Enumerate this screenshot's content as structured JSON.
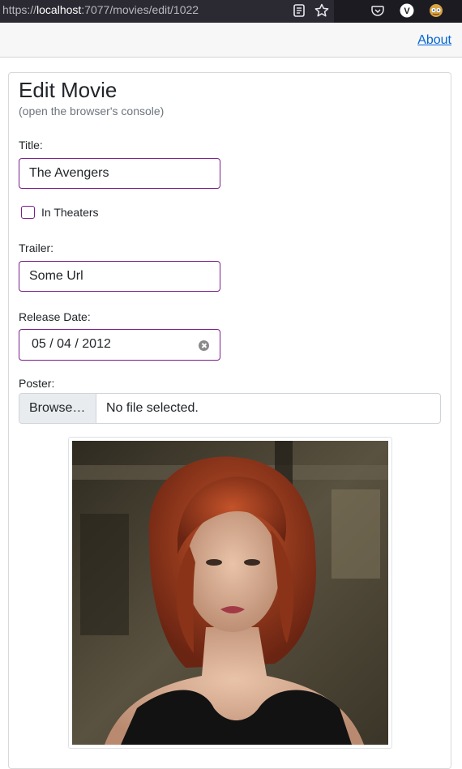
{
  "browser": {
    "url_scheme": "https://",
    "url_host": "localhost",
    "url_path": ":7077/movies/edit/1022",
    "profile_letter": "V"
  },
  "nav": {
    "about_label": "About"
  },
  "form": {
    "heading": "Edit Movie",
    "subheading": "(open the browser's console)",
    "title_label": "Title:",
    "title_value": "The Avengers",
    "in_theaters_label": "In Theaters",
    "in_theaters_checked": false,
    "trailer_label": "Trailer:",
    "trailer_value": "Some Url",
    "release_date_label": "Release Date:",
    "release_date_value": "05 / 04 / 2012",
    "poster_label": "Poster:",
    "browse_label": "Browse…",
    "file_status": "No file selected."
  },
  "colors": {
    "accent_border": "#7a1f8a",
    "link": "#0366d6"
  }
}
